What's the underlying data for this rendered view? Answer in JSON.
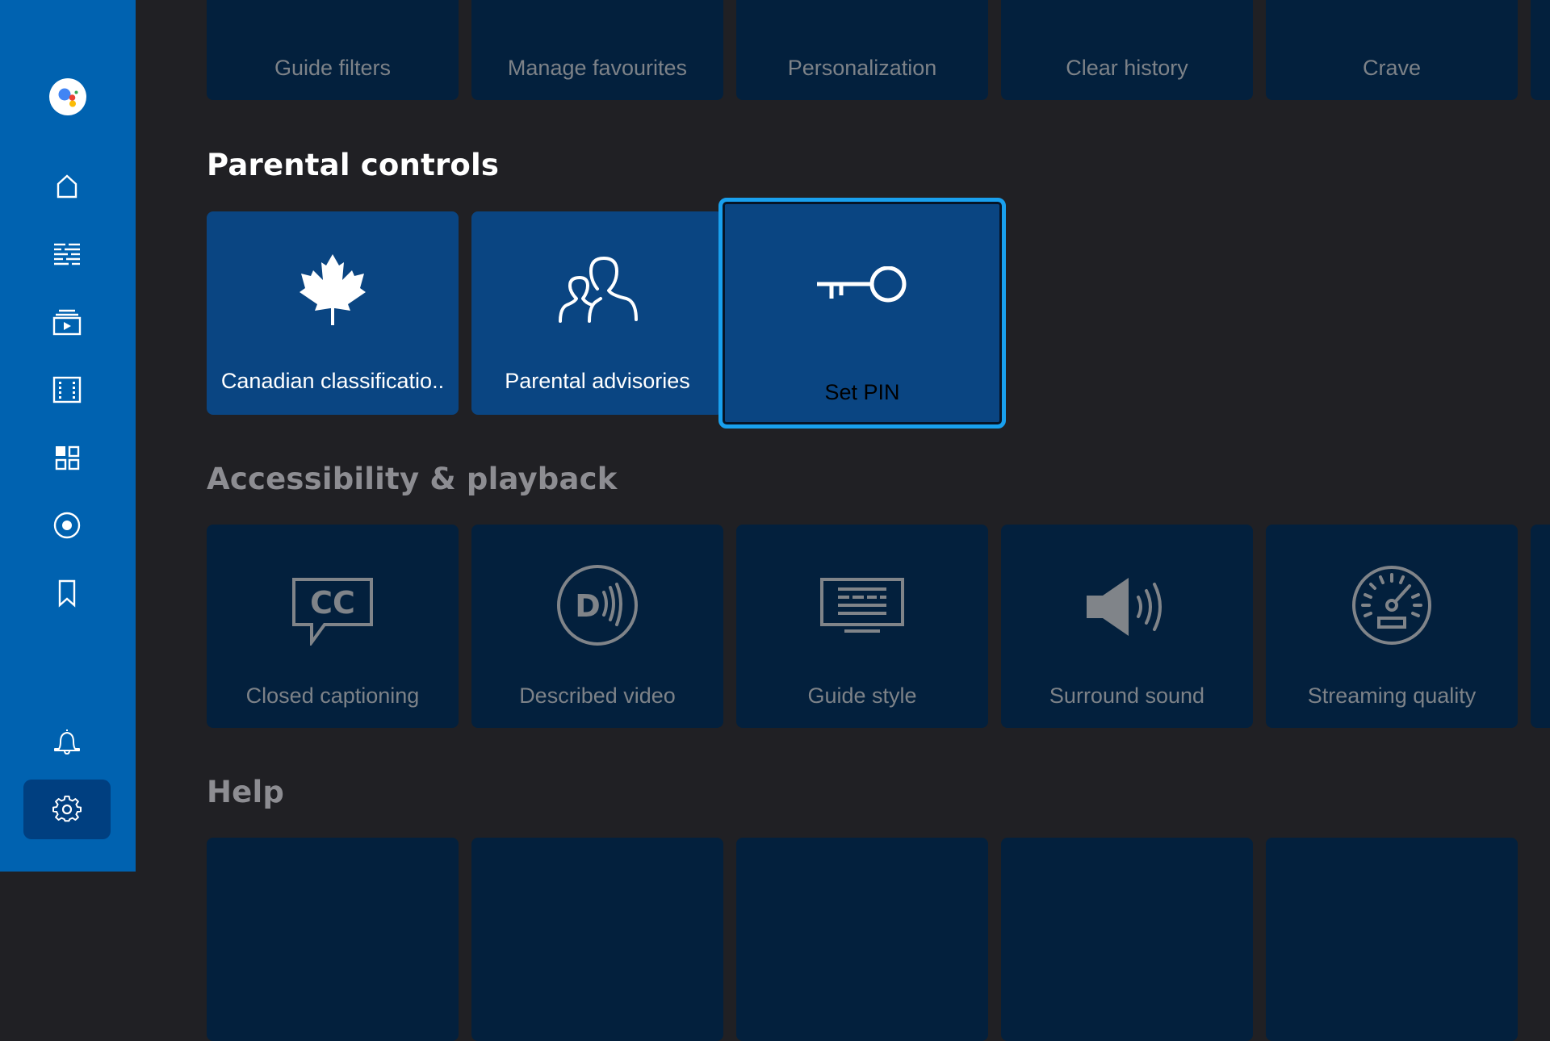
{
  "sidebar": {
    "items": [
      {
        "name": "google-assistant",
        "icon": "google-assistant-icon"
      },
      {
        "name": "home",
        "icon": "home-icon"
      },
      {
        "name": "guide",
        "icon": "guide-grid-icon"
      },
      {
        "name": "on-demand",
        "icon": "video-library-icon"
      },
      {
        "name": "movies",
        "icon": "film-strip-icon"
      },
      {
        "name": "apps",
        "icon": "apps-grid-icon"
      },
      {
        "name": "recordings",
        "icon": "record-icon"
      },
      {
        "name": "bookmarks",
        "icon": "bookmark-icon"
      },
      {
        "name": "notifications",
        "icon": "bell-icon"
      },
      {
        "name": "settings",
        "icon": "gear-icon",
        "active": true
      }
    ],
    "colors": {
      "background": "#0062b0",
      "active": "#003f80"
    }
  },
  "sections": {
    "top_row": {
      "tiles": [
        {
          "label": "Guide filters",
          "icon": "filter-icon"
        },
        {
          "label": "Manage favourites",
          "icon": "heart-icon"
        },
        {
          "label": "Personalization",
          "icon": "personalization-icon"
        },
        {
          "label": "Clear history",
          "icon": "trash-icon"
        },
        {
          "label": "Crave",
          "icon": "crave-icon"
        }
      ]
    },
    "parental": {
      "title": "Parental controls",
      "tiles": [
        {
          "label": "Canadian classificatio..",
          "icon": "maple-leaf-icon"
        },
        {
          "label": "Parental advisories",
          "icon": "people-icon"
        },
        {
          "label": "Set PIN",
          "icon": "key-icon",
          "focused": true
        }
      ]
    },
    "accessibility": {
      "title": "Accessibility & playback",
      "tiles": [
        {
          "label": "Closed captioning",
          "icon": "closed-caption-icon"
        },
        {
          "label": "Described video",
          "icon": "described-video-icon"
        },
        {
          "label": "Guide style",
          "icon": "guide-style-icon"
        },
        {
          "label": "Surround sound",
          "icon": "speaker-icon"
        },
        {
          "label": "Streaming quality",
          "icon": "speedometer-icon"
        }
      ]
    },
    "help": {
      "title": "Help"
    }
  },
  "colors": {
    "background": "#202024",
    "tile_dim": "#03203d",
    "tile_active": "#0a4582",
    "focus_ring": "#19a0ee"
  }
}
